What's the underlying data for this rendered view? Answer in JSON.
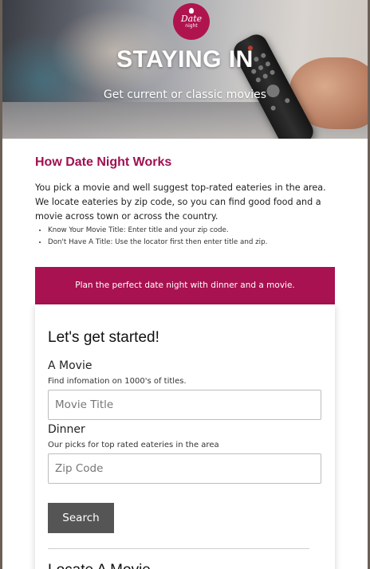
{
  "hero": {
    "logo_line1": "Date",
    "logo_line2": "night",
    "title": "STAYING IN",
    "subtitle": "Get current or classic movies"
  },
  "intro": {
    "heading": "How Date Night Works",
    "paragraph": "You pick a movie and well suggest top-rated eateries in the area. We locate eateries by zip code, so you can find good food and a movie across town or across the country.",
    "bullets": [
      "Know Your Movie Title: Enter title and your zip code.",
      "Don't Have A Title: Use the locator first then enter title and zip."
    ]
  },
  "banner": {
    "text": "Plan the perfect date night with dinner and a movie."
  },
  "form": {
    "heading": "Let's get started!",
    "movie": {
      "label": "A Movie",
      "help": "Find infomation on 1000's of titles.",
      "placeholder": "Movie Title",
      "value": ""
    },
    "dinner": {
      "label": "Dinner",
      "help": "Our picks for top rated eateries in the area",
      "placeholder": "Zip Code",
      "value": ""
    },
    "search_label": "Search",
    "next_heading": "Locate A Movie"
  },
  "icons": [
    "logo-badge",
    "remote-control"
  ],
  "colors": {
    "brand": "#a81250",
    "heading": "#a01050",
    "button": "#555555"
  }
}
